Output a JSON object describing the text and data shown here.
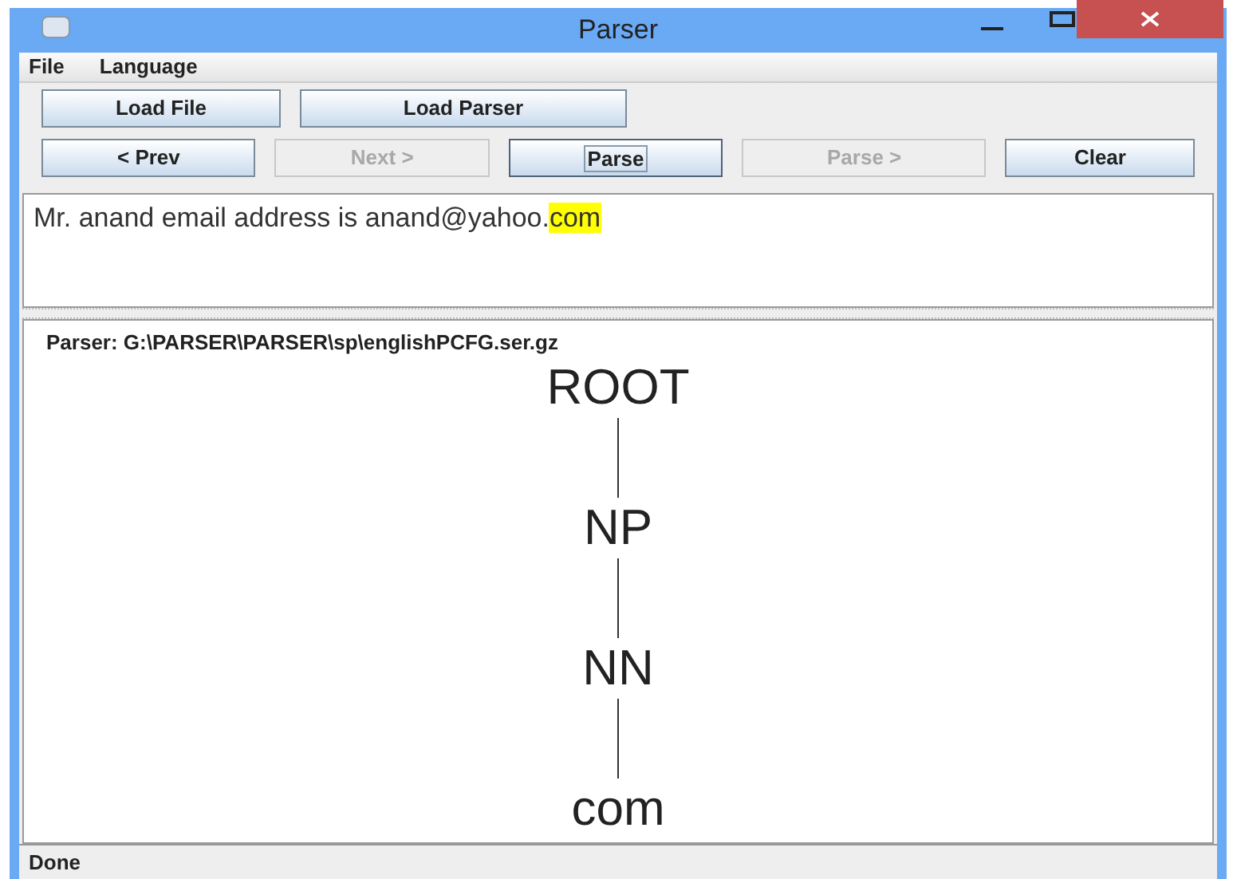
{
  "window": {
    "title": "Parser"
  },
  "menu": [
    {
      "label": "File"
    },
    {
      "label": "Language"
    }
  ],
  "toolbar_rows": [
    [
      {
        "label": "Load File",
        "disabled": false,
        "focused": false
      },
      {
        "label": "Load Parser",
        "disabled": false,
        "focused": false
      }
    ],
    [
      {
        "label": "< Prev",
        "disabled": false,
        "focused": false
      },
      {
        "label": "Next >",
        "disabled": true,
        "focused": false
      },
      {
        "label": "Parse",
        "disabled": false,
        "focused": true
      },
      {
        "label": "Parse >",
        "disabled": true,
        "focused": false
      },
      {
        "label": "Clear",
        "disabled": false,
        "focused": false
      }
    ]
  ],
  "input": {
    "text": "Mr. anand email address is anand@yahoo.",
    "highlighted": "com"
  },
  "tree_panel": {
    "parser_label": "Parser: G:\\PARSER\\PARSER\\sp\\englishPCFG.ser.gz",
    "tree": {
      "label": "ROOT",
      "children": [
        {
          "label": "NP",
          "children": [
            {
              "label": "NN",
              "children": [
                {
                  "label": "com"
                }
              ]
            }
          ]
        }
      ]
    }
  },
  "status_bar": "Done"
}
